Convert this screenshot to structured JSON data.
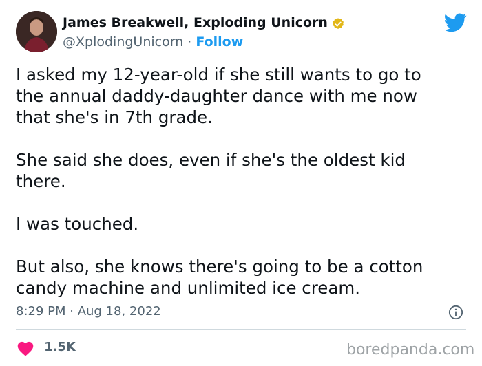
{
  "author": {
    "display_name": "James Breakwell, Exploding Unicorn",
    "handle": "@XplodingUnicorn",
    "separator": " · ",
    "follow_label": "Follow",
    "verified": true
  },
  "tweet": {
    "paragraphs": [
      [
        "I asked my 12-year-old if she still wants to go to",
        "the annual daddy-daughter dance with me now",
        "that she's in 7th grade."
      ],
      [
        "She said she does, even if she's the oldest kid",
        "there."
      ],
      [
        "I was touched."
      ],
      [
        "But also, she knows there's going to be a cotton",
        "candy machine and unlimited ice cream."
      ]
    ],
    "timestamp": "8:29 PM · Aug 18, 2022"
  },
  "engagement": {
    "likes": "1.5K"
  },
  "watermark": "boredpanda.com",
  "colors": {
    "twitter_blue": "#1d9bf0",
    "verified_gold": "#e2b719",
    "heart_red": "#f91880",
    "secondary_text": "#536471"
  },
  "icons": {
    "brand": "twitter-bird-icon",
    "verified": "verified-badge-icon",
    "info": "info-icon",
    "like": "heart-icon"
  }
}
